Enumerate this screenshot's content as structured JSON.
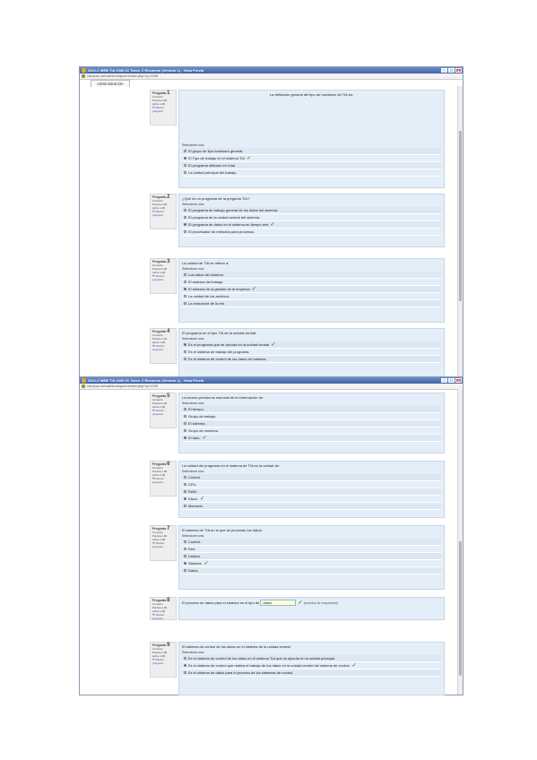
{
  "window1": {
    "title": "2012-2 WEB TIA 2000-01 Tarea: 2 Resumen (Versión 1) - Vista Previa",
    "address": "campus.virtual/mod/quiz/review.php?q=1205",
    "tab": "Administración",
    "buttons": {
      "minimize": "_",
      "maximize": "□",
      "close": "x"
    }
  },
  "window2": {
    "title": "2012-2 WEB TIA 2000-01 Tarea: 2 Resumen (Versión 1) - Vista Previa",
    "address": "campus.virtual/mod/quiz/review.php?q=1205",
    "buttons": {
      "minimize": "_",
      "maximize": "□",
      "close": "x"
    }
  },
  "meta": {
    "status": "Correcto",
    "score": "Puntúa 1,00 sobre 1,00",
    "flag": "Marcar pregunta",
    "select_label": "Seleccione una:"
  },
  "questions": [
    {
      "label": "Pregunta",
      "num": "1",
      "text": "La definición general del tipo de hardware de TIA es:",
      "options": [
        {
          "text": "El grupo de tipo hardware general.",
          "checked": false
        },
        {
          "text": "El Tipo de trabajo en el sistema TIA",
          "checked": true
        },
        {
          "text": "El programa utilizado en total.",
          "checked": false
        },
        {
          "text": "La unidad principal del trabajo.",
          "checked": false
        }
      ]
    },
    {
      "label": "Pregunta",
      "num": "2",
      "text": "¿Qué es un programa de la pregunta TIA?",
      "options": [
        {
          "text": "El programa de trabajo general de los datos del sistema",
          "checked": false
        },
        {
          "text": "El programa de la unidad central del sistema.",
          "checked": false
        },
        {
          "text": "El programa de datos en el sistema en tiempo real",
          "checked": true
        },
        {
          "text": "El procesador de métodos para procesos.",
          "checked": false
        }
      ]
    },
    {
      "label": "Pregunta",
      "num": "3",
      "text": "La unidad de TIA se refiere a:",
      "options": [
        {
          "text": "Los datos del sistema.",
          "checked": false
        },
        {
          "text": "El sistema del trabajo.",
          "checked": false
        },
        {
          "text": "El sistema de la gestión de la empresa",
          "checked": true
        },
        {
          "text": "La unidad de los archivos.",
          "checked": false
        },
        {
          "text": "La estructura de la red.",
          "checked": false
        }
      ]
    },
    {
      "label": "Pregunta",
      "num": "4",
      "text": "El programa en el tipo TIA de la unidad central:",
      "options": [
        {
          "text": "Es el programa que se ejecuta en la unidad central",
          "checked": true
        },
        {
          "text": "Es el sistema de trabajo del programa.",
          "checked": false
        },
        {
          "text": "Es el sistema de control de los datos del sistema.",
          "checked": false
        }
      ]
    },
    {
      "label": "Pregunta",
      "num": "5",
      "text": "La lectura precisa es esencial de la información de:",
      "options": [
        {
          "text": "El tiempo.",
          "checked": false
        },
        {
          "text": "Grupo de trabajo.",
          "checked": false
        },
        {
          "text": "El sistema.",
          "checked": false
        },
        {
          "text": "Grupo de vectores.",
          "checked": false
        },
        {
          "text": "El dato.",
          "checked": true
        }
      ]
    },
    {
      "label": "Pregunta",
      "num": "6",
      "text": "La unidad del programa en el sistema de TIA es la unidad de:",
      "options": [
        {
          "text": "Control.",
          "checked": false
        },
        {
          "text": "CPU.",
          "checked": false
        },
        {
          "text": "RAM.",
          "checked": false
        },
        {
          "text": "Disco.",
          "checked": true
        },
        {
          "text": "Memoria.",
          "checked": false
        }
      ]
    },
    {
      "label": "Pregunta",
      "num": "7",
      "text": "El sistema de TIA en el que se procesan los datos:",
      "options": [
        {
          "text": "Control.",
          "checked": false
        },
        {
          "text": "Red.",
          "checked": false
        },
        {
          "text": "Unidad.",
          "checked": false
        },
        {
          "text": "Sistema.",
          "checked": true
        },
        {
          "text": "Datos.",
          "checked": false
        }
      ]
    },
    {
      "label": "Pregunta",
      "num": "8",
      "text_before": "El proceso de datos para el sistema es el tipo de",
      "answer": "datos",
      "text_after": "(escriba la respuesta)",
      "options": []
    },
    {
      "label": "Pregunta",
      "num": "9",
      "text": "El sistema de control de los datos en el sistema de la unidad central:",
      "options": [
        {
          "text": "Es el sistema de control de los datos en el sistema TIA que se ejecuta en la unidad principal.",
          "checked": false
        },
        {
          "text": "Es el sistema de control que realiza el trabajo de los datos en la unidad central del sistema de control.",
          "checked": true
        },
        {
          "text": "Es el sistema de datos para el proceso de los sistemas de control.",
          "checked": false
        }
      ]
    }
  ],
  "colors": {
    "accent": "#3f63a6",
    "panel": "#e4eef8",
    "check": "#2aa31f"
  }
}
